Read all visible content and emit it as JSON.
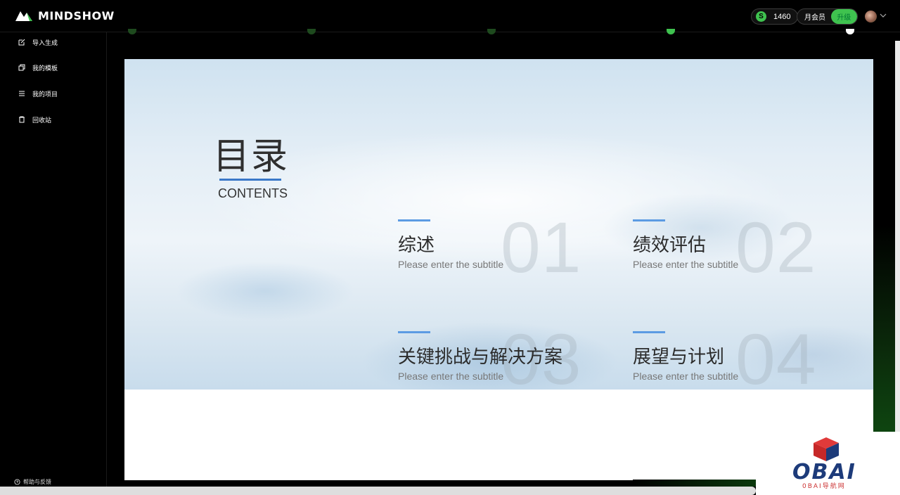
{
  "header": {
    "brand": "MINDSHOW",
    "coin_symbol": "S",
    "coin_count": "1460",
    "member_label": "月会员",
    "upgrade_label": "升级"
  },
  "sidebar": {
    "items": [
      {
        "label": "导入生成",
        "icon": "import-icon"
      },
      {
        "label": "我的模板",
        "icon": "template-icon"
      },
      {
        "label": "我的项目",
        "icon": "list-icon"
      },
      {
        "label": "回收站",
        "icon": "trash-icon"
      }
    ],
    "help_label": "帮助与反馈"
  },
  "slide": {
    "title": "目录",
    "contents_label": "CONTENTS",
    "items": [
      {
        "number": "01",
        "label": "综述",
        "subtitle": "Please enter the subtitle"
      },
      {
        "number": "02",
        "label": "绩效评估",
        "subtitle": "Please enter the subtitle"
      },
      {
        "number": "03",
        "label": "关键挑战与解决方案",
        "subtitle": "Please enter the subtitle"
      },
      {
        "number": "04",
        "label": "展望与计划",
        "subtitle": "Please enter the subtitle"
      }
    ]
  },
  "watermark": {
    "brand": "OBAI",
    "sub": "0BAI导航网"
  },
  "colors": {
    "accent_green": "#3fc24f",
    "slide_accent_blue": "#5c9be3",
    "contents_line": "#3a78c8",
    "watermark_blue": "#1d3b7a",
    "watermark_red": "#cc3333"
  }
}
